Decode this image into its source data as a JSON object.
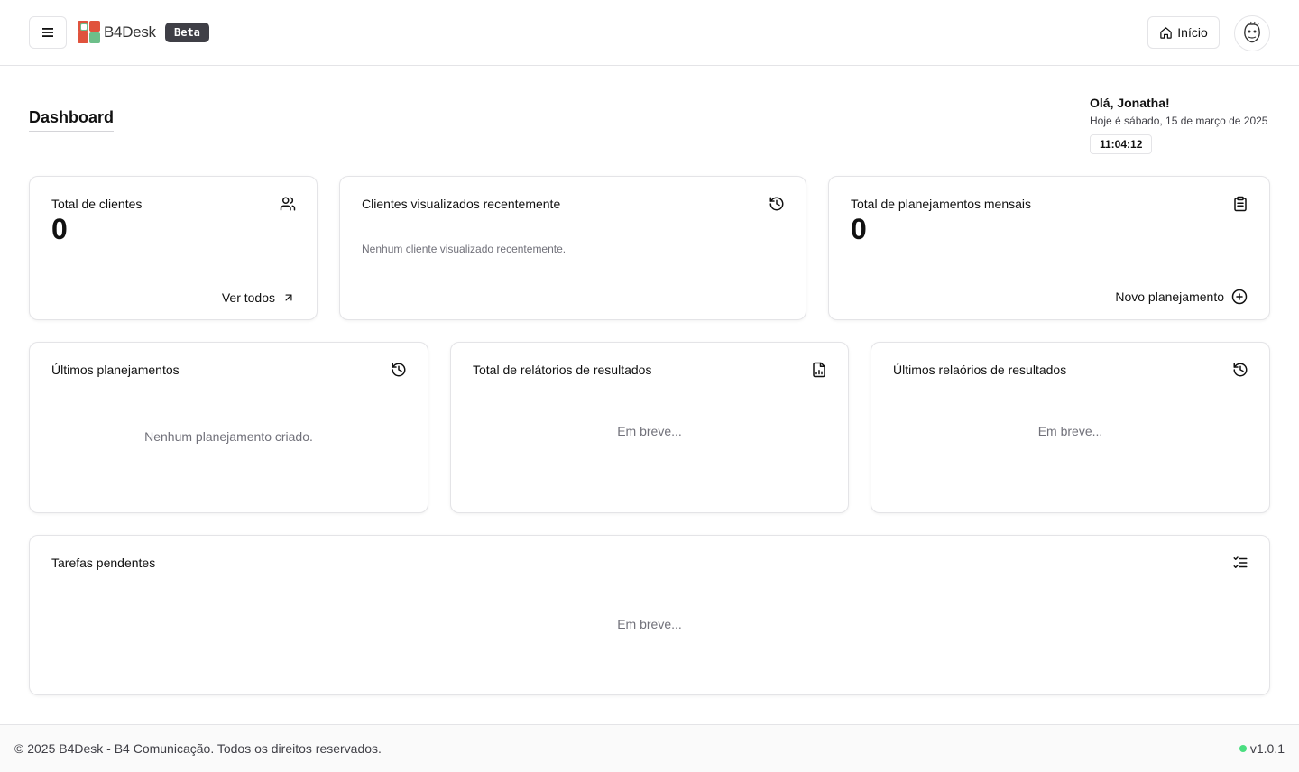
{
  "header": {
    "brand": "B4Desk",
    "badge": "Beta",
    "home_label": "Início",
    "icons": {
      "menu": "hamburger-icon",
      "home": "home-icon",
      "avatar": "user-avatar"
    }
  },
  "page": {
    "title": "Dashboard",
    "greeting": "Olá, Jonatha!",
    "date_text": "Hoje é sábado, 15 de março de 2025",
    "clock": "11:04:12"
  },
  "cards": {
    "clients": {
      "title": "Total de clientes",
      "value": "0",
      "link": "Ver todos",
      "icon": "users-icon"
    },
    "recent": {
      "title": "Clientes visualizados recentemente",
      "empty": "Nenhum cliente visualizado recentemente.",
      "icon": "history-icon"
    },
    "plans_total": {
      "title": "Total de planejamentos mensais",
      "value": "0",
      "link": "Novo planejamento",
      "icon": "clipboard-icon"
    },
    "last_plans": {
      "title": "Últimos planejamentos",
      "empty": "Nenhum planejamento criado.",
      "icon": "history-icon"
    },
    "reports_total": {
      "title": "Total de relátorios de resultados",
      "empty": "Em breve...",
      "icon": "file-chart-icon"
    },
    "last_reports": {
      "title": "Últimos relaórios de resultados",
      "empty": "Em breve...",
      "icon": "history-icon"
    },
    "tasks": {
      "title": "Tarefas pendentes",
      "empty": "Em breve...",
      "icon": "list-check-icon"
    }
  },
  "footer": {
    "copyright": "© 2025 B4Desk - B4 Comunicação. Todos os direitos reservados.",
    "version": "v1.0.1"
  },
  "colors": {
    "logo_red": "#e0533d",
    "logo_green": "#6dbf8a",
    "badge_bg": "#3f3f46",
    "status_dot": "#4ade80"
  }
}
